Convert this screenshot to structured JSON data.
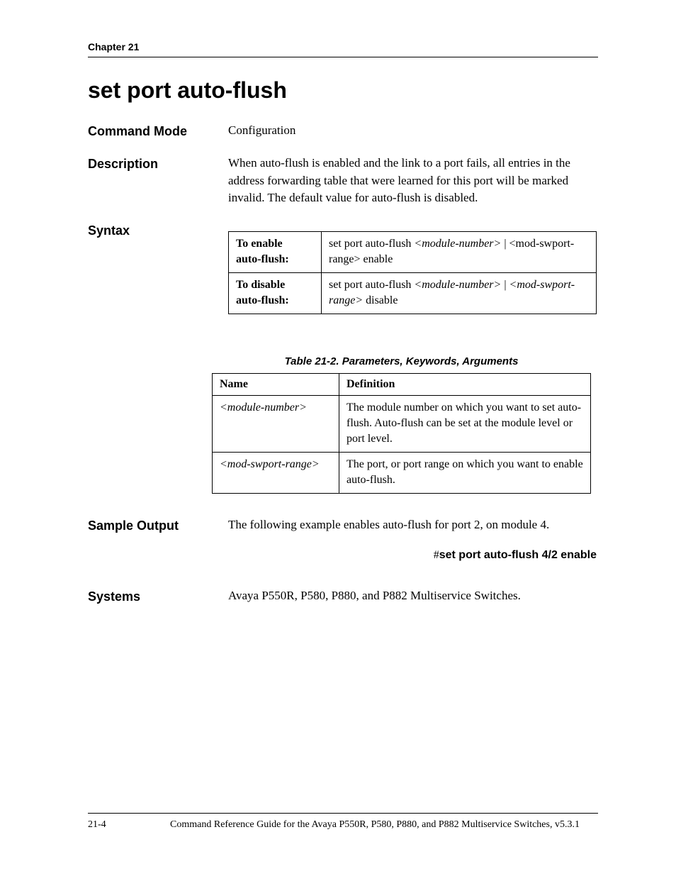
{
  "running_head": "Chapter 21",
  "title": "set port auto-flush",
  "rows": {
    "command_mode": {
      "label": "Command Mode",
      "text": "Configuration"
    },
    "description": {
      "label": "Description",
      "text": "When auto-flush is enabled and the link to a port fails, all entries in the address forwarding table that were learned for this port will be marked invalid. The default value for auto-flush is disabled."
    },
    "syntax_label": "Syntax",
    "sample_output": {
      "label": "Sample Output",
      "text": "The following example enables auto-flush for port 2, on module 4."
    },
    "systems": {
      "label": "Systems",
      "text": "Avaya P550R, P580, P880, and P882 Multiservice Switches."
    }
  },
  "syntax_table": [
    {
      "left_l1": "To enable",
      "left_l2": "auto-flush:",
      "right_pre": "set port auto-flush ",
      "right_it1": "<module-number>",
      "right_mid": " | <mod-swport-range> enable"
    },
    {
      "left_l1": "To disable",
      "left_l2": "auto-flush:",
      "right_pre": "set port auto-flush ",
      "right_it1": "<module-number>",
      "right_mid": " | ",
      "right_it2": "<mod-swport-range>",
      "right_post": " disable"
    }
  ],
  "param_caption": "Table 21-2.  Parameters, Keywords, Arguments",
  "param_headers": {
    "name": "Name",
    "def": "Definition"
  },
  "param_rows": [
    {
      "name": "<module-number>",
      "def": "The module number on which you want to set auto-flush. Auto-flush can be set at the module level or port level."
    },
    {
      "name": "<mod-swport-range>",
      "def": "The port, or port range on which you want to enable auto-flush."
    }
  ],
  "sample_command": {
    "hash": "#",
    "cmd": "set port auto-flush 4/2 enable"
  },
  "footer": {
    "pageno": "21-4",
    "text": "Command Reference Guide for the Avaya P550R, P580, P880, and P882 Multiservice Switches, v5.3.1"
  }
}
